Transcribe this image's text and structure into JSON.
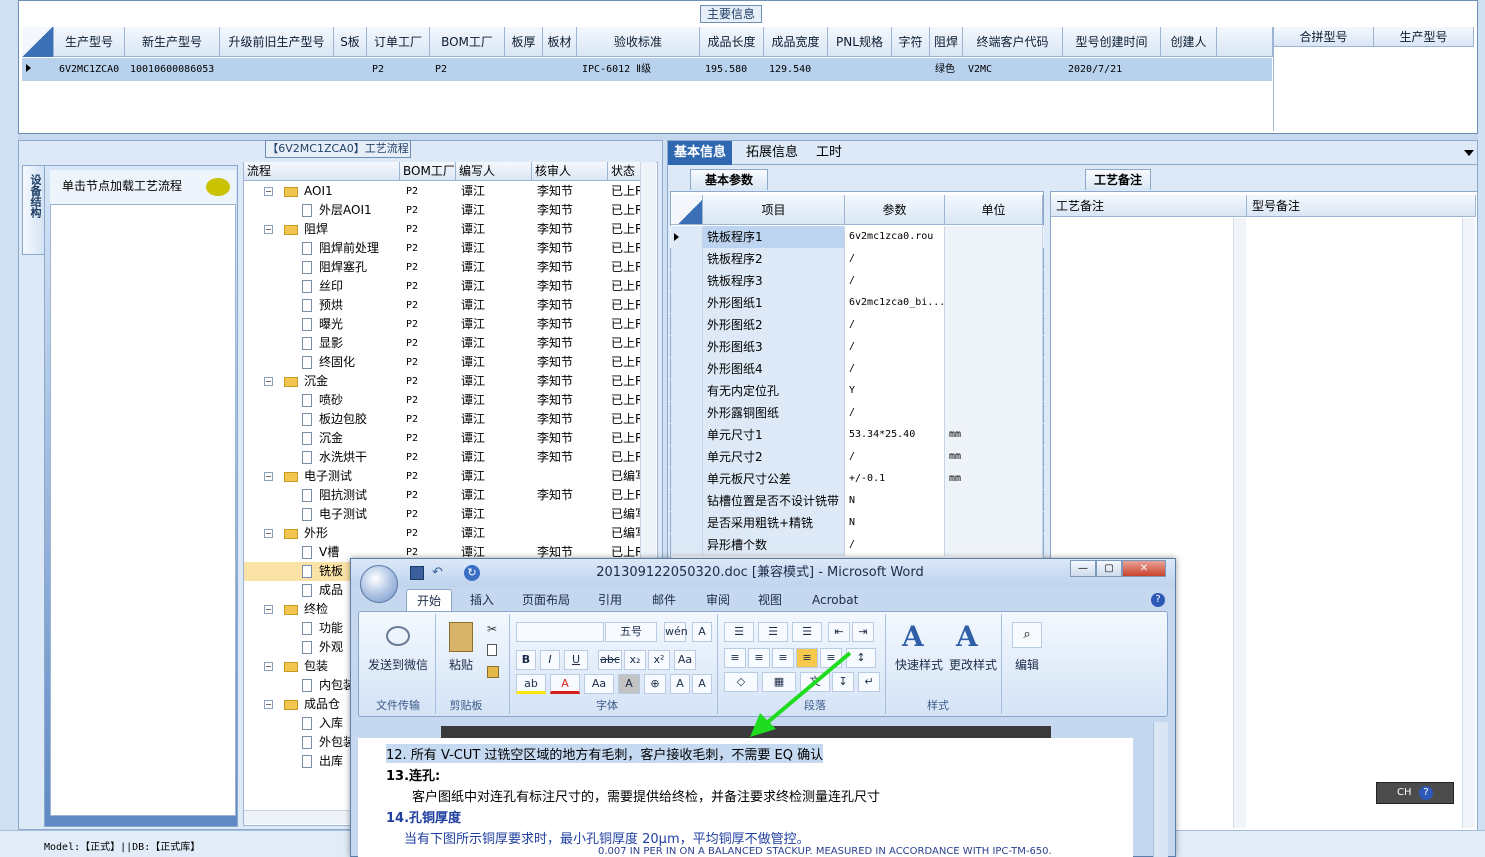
{
  "main_info": {
    "title": "主要信息",
    "columns": [
      "生产型号",
      "新生产型号",
      "升级前旧生产型号",
      "S板",
      "订单工厂",
      "BOM工厂",
      "板厚",
      "板材",
      "验收标准",
      "成品长度",
      "成品宽度",
      "PNL规格",
      "字符",
      "阻焊",
      "终端客户代码",
      "型号创建时间",
      "创建人"
    ],
    "row": [
      "6V2MC1ZCA0",
      "10010600086053",
      "",
      "",
      "P2",
      "P2",
      "",
      "",
      "IPC-6012 Ⅱ级",
      "195.580",
      "129.540",
      "",
      "",
      "绿色",
      "V2MC",
      "2020/7/21",
      ""
    ],
    "side_columns": [
      "合拼型号",
      "生产型号"
    ]
  },
  "left": {
    "flow_title": "【6V2MC1ZCA0】工艺流程",
    "vtab": "设备结构",
    "node_hint": "单击节点加载工艺流程",
    "tree_columns": [
      "流程",
      "BOM工厂",
      "编写人",
      "核审人",
      "状态"
    ],
    "tree_rows": [
      {
        "name": "AOI1",
        "level": 0,
        "kind": "folder",
        "bom": "P2",
        "writer": "谭江",
        "reviewer": "李知节",
        "status": "已上R"
      },
      {
        "name": "外层AOI1",
        "level": 1,
        "kind": "doc",
        "bom": "P2",
        "writer": "谭江",
        "reviewer": "李知节",
        "status": "已上R"
      },
      {
        "name": "阻焊",
        "level": 0,
        "kind": "folder",
        "bom": "P2",
        "writer": "谭江",
        "reviewer": "李知节",
        "status": "已上R"
      },
      {
        "name": "阻焊前处理",
        "level": 1,
        "kind": "doc",
        "bom": "P2",
        "writer": "谭江",
        "reviewer": "李知节",
        "status": "已上R"
      },
      {
        "name": "阻焊塞孔",
        "level": 1,
        "kind": "doc",
        "bom": "P2",
        "writer": "谭江",
        "reviewer": "李知节",
        "status": "已上R"
      },
      {
        "name": "丝印",
        "level": 1,
        "kind": "doc",
        "bom": "P2",
        "writer": "谭江",
        "reviewer": "李知节",
        "status": "已上R"
      },
      {
        "name": "预烘",
        "level": 1,
        "kind": "doc",
        "bom": "P2",
        "writer": "谭江",
        "reviewer": "李知节",
        "status": "已上R"
      },
      {
        "name": "曝光",
        "level": 1,
        "kind": "doc",
        "bom": "P2",
        "writer": "谭江",
        "reviewer": "李知节",
        "status": "已上R"
      },
      {
        "name": "显影",
        "level": 1,
        "kind": "doc",
        "bom": "P2",
        "writer": "谭江",
        "reviewer": "李知节",
        "status": "已上R"
      },
      {
        "name": "终固化",
        "level": 1,
        "kind": "doc",
        "bom": "P2",
        "writer": "谭江",
        "reviewer": "李知节",
        "status": "已上R"
      },
      {
        "name": "沉金",
        "level": 0,
        "kind": "folder",
        "bom": "P2",
        "writer": "谭江",
        "reviewer": "李知节",
        "status": "已上R"
      },
      {
        "name": "喷砂",
        "level": 1,
        "kind": "doc",
        "bom": "P2",
        "writer": "谭江",
        "reviewer": "李知节",
        "status": "已上R"
      },
      {
        "name": "板边包胶",
        "level": 1,
        "kind": "doc",
        "bom": "P2",
        "writer": "谭江",
        "reviewer": "李知节",
        "status": "已上R"
      },
      {
        "name": "沉金",
        "level": 1,
        "kind": "doc",
        "bom": "P2",
        "writer": "谭江",
        "reviewer": "李知节",
        "status": "已上R"
      },
      {
        "name": "水洗烘干",
        "level": 1,
        "kind": "doc",
        "bom": "P2",
        "writer": "谭江",
        "reviewer": "李知节",
        "status": "已上R"
      },
      {
        "name": "电子测试",
        "level": 0,
        "kind": "folder",
        "bom": "P2",
        "writer": "谭江",
        "reviewer": "",
        "status": "已编写"
      },
      {
        "name": "阻抗测试",
        "level": 1,
        "kind": "doc",
        "bom": "P2",
        "writer": "谭江",
        "reviewer": "李知节",
        "status": "已上R"
      },
      {
        "name": "电子测试",
        "level": 1,
        "kind": "doc",
        "bom": "P2",
        "writer": "谭江",
        "reviewer": "",
        "status": "已编写"
      },
      {
        "name": "外形",
        "level": 0,
        "kind": "folder",
        "bom": "P2",
        "writer": "谭江",
        "reviewer": "",
        "status": "已编写"
      },
      {
        "name": "V槽",
        "level": 1,
        "kind": "doc",
        "bom": "P2",
        "writer": "谭江",
        "reviewer": "李知节",
        "status": "已上R"
      },
      {
        "name": "铣板",
        "level": 1,
        "kind": "doc",
        "bom": "",
        "writer": "",
        "reviewer": "",
        "status": ""
      },
      {
        "name": "成品",
        "level": 1,
        "kind": "doc",
        "bom": "",
        "writer": "",
        "reviewer": "",
        "status": ""
      },
      {
        "name": "终检",
        "level": 0,
        "kind": "folder",
        "bom": "",
        "writer": "",
        "reviewer": "",
        "status": ""
      },
      {
        "name": "功能",
        "level": 1,
        "kind": "doc",
        "bom": "",
        "writer": "",
        "reviewer": "",
        "status": ""
      },
      {
        "name": "外观",
        "level": 1,
        "kind": "doc",
        "bom": "",
        "writer": "",
        "reviewer": "",
        "status": ""
      },
      {
        "name": "包装",
        "level": 0,
        "kind": "folder",
        "bom": "",
        "writer": "",
        "reviewer": "",
        "status": ""
      },
      {
        "name": "内包装",
        "level": 1,
        "kind": "doc",
        "bom": "",
        "writer": "",
        "reviewer": "",
        "status": ""
      },
      {
        "name": "成品仓",
        "level": 0,
        "kind": "folder",
        "bom": "",
        "writer": "",
        "reviewer": "",
        "status": ""
      },
      {
        "name": "入库",
        "level": 1,
        "kind": "doc",
        "bom": "",
        "writer": "",
        "reviewer": "",
        "status": ""
      },
      {
        "name": "外包装",
        "level": 1,
        "kind": "doc",
        "bom": "",
        "writer": "",
        "reviewer": "",
        "status": ""
      },
      {
        "name": "出库",
        "level": 1,
        "kind": "doc",
        "bom": "",
        "writer": "",
        "reviewer": "",
        "status": ""
      }
    ]
  },
  "right": {
    "tabs": [
      "基本信息",
      "拓展信息",
      "工时"
    ],
    "subtab": "基本参数",
    "param_columns": [
      "项目",
      "参数",
      "单位"
    ],
    "params": [
      {
        "item": "铣板程序1",
        "value": "6v2mc1zca0.rou",
        "unit": ""
      },
      {
        "item": "铣板程序2",
        "value": "/",
        "unit": ""
      },
      {
        "item": "铣板程序3",
        "value": "/",
        "unit": ""
      },
      {
        "item": "外形图纸1",
        "value": "6v2mc1zca0_bi...",
        "unit": ""
      },
      {
        "item": "外形图纸2",
        "value": "/",
        "unit": ""
      },
      {
        "item": "外形图纸3",
        "value": "/",
        "unit": ""
      },
      {
        "item": "外形图纸4",
        "value": "/",
        "unit": ""
      },
      {
        "item": "有无内定位孔",
        "value": "Y",
        "unit": ""
      },
      {
        "item": "外形露铜图纸",
        "value": "/",
        "unit": ""
      },
      {
        "item": "单元尺寸1",
        "value": "53.34*25.40",
        "unit": "mm"
      },
      {
        "item": "单元尺寸2",
        "value": "/",
        "unit": "mm"
      },
      {
        "item": "单元板尺寸公差",
        "value": "+/-0.1",
        "unit": "mm"
      },
      {
        "item": "钻槽位置是否不设计铣带",
        "value": "N",
        "unit": ""
      },
      {
        "item": "是否采用粗铣+精铣",
        "value": "N",
        "unit": ""
      },
      {
        "item": "异形槽个数",
        "value": "/",
        "unit": ""
      }
    ],
    "notes_tab": "工艺备注",
    "notes_columns": [
      "工艺备注",
      "型号备注"
    ]
  },
  "status_bar": "Model:【正式】||DB:【正式库】",
  "ime": "CH",
  "word": {
    "title": "201309122050320.doc [兼容模式] - Microsoft Word",
    "tabs": [
      "开始",
      "插入",
      "页面布局",
      "引用",
      "邮件",
      "审阅",
      "视图",
      "Acrobat"
    ],
    "send_wechat": "发送到微信",
    "paste": "粘贴",
    "font_size": "五号",
    "quick_style": "快速样式",
    "change_style": "更改样式",
    "edit": "编辑",
    "groups": [
      "文件传输",
      "剪贴板",
      "字体",
      "段落",
      "样式"
    ],
    "doc_lines": [
      "12. 所有 V-CUT 过铣空区域的地方有毛刺，客户接收毛刺，不需要 EQ 确认",
      "13.连孔:",
      "客户图纸中对连孔有标注尺寸的，需要提供给终检，并备注要求终检测量连孔尺寸",
      "14.孔铜厚度",
      "当有下图所示铜厚要求时，最小孔铜厚度 20μm，平均铜厚不做管控。",
      "0.007 IN PER IN ON A BALANCED STACKUP.  MEASURED IN ACCORDANCE WITH IPC-TM-650."
    ]
  }
}
